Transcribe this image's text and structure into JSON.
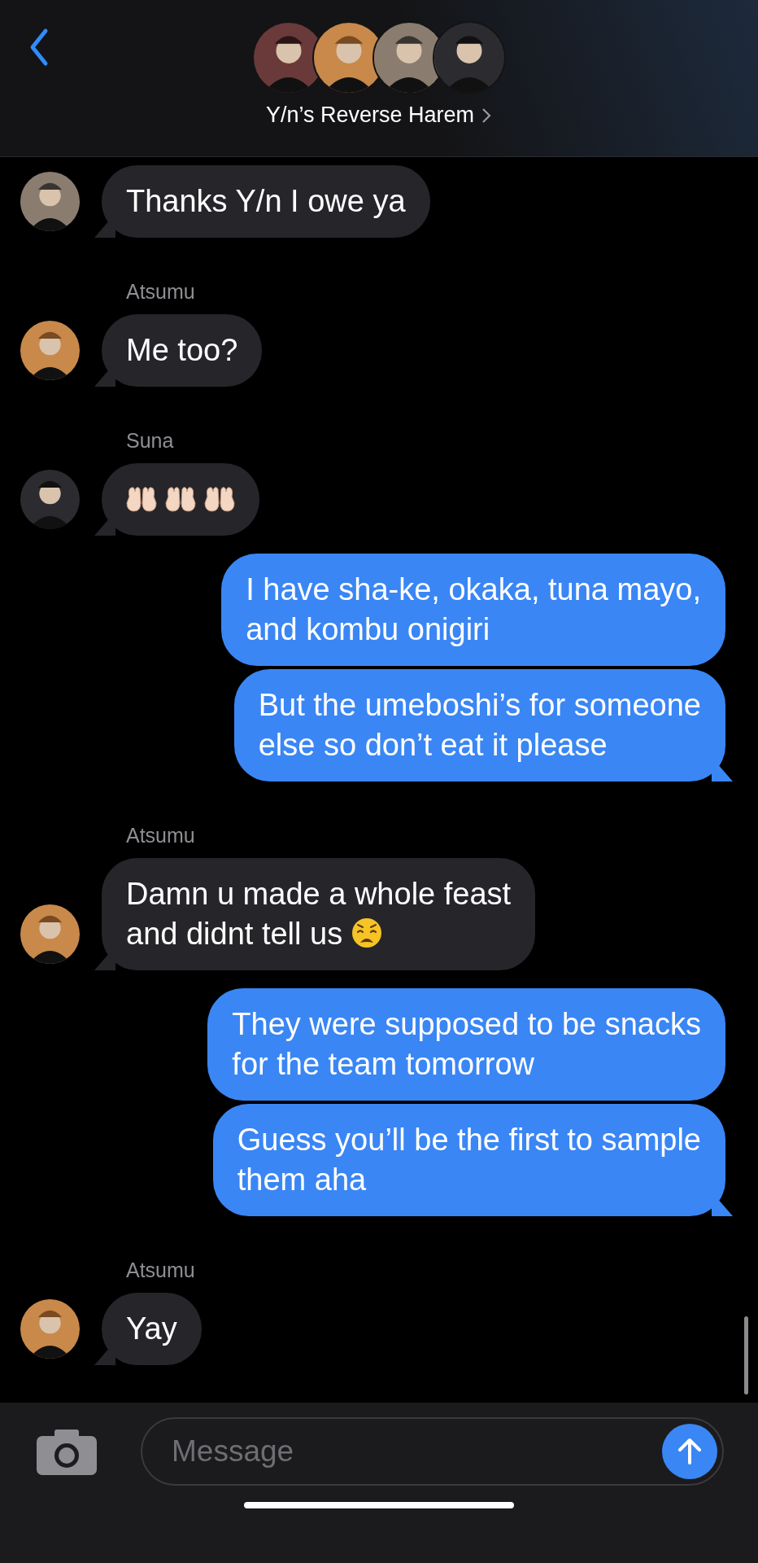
{
  "header": {
    "title": "Y/n’s Reverse Harem"
  },
  "messages": [
    {
      "kind": "received",
      "bubbles": [
        {
          "kind": "text",
          "text": "Thanks Y/n I owe ya"
        }
      ]
    },
    {
      "kind": "received",
      "name": "Atsumu",
      "bubbles": [
        {
          "kind": "text",
          "text": "Me too?"
        }
      ]
    },
    {
      "kind": "received",
      "name": "Suna",
      "bubbles": [
        {
          "kind": "emoji_row"
        }
      ]
    },
    {
      "kind": "sent",
      "bubbles": [
        {
          "kind": "text",
          "text": "I have sha-ke, okaka, tuna mayo,\nand kombu onigiri"
        },
        {
          "kind": "text",
          "text": "But the umeboshi’s for someone\nelse so don’t eat it please"
        }
      ]
    },
    {
      "kind": "received",
      "name": "Atsumu",
      "bubbles": [
        {
          "kind": "text_emoji",
          "text": "Damn u made a whole feast\nand didnt tell us"
        }
      ]
    },
    {
      "kind": "sent",
      "bubbles": [
        {
          "kind": "text",
          "text": "They were supposed to be snacks\nfor the team tomorrow"
        },
        {
          "kind": "text",
          "text": "Guess you’ll be the first to sample\nthem aha"
        }
      ]
    },
    {
      "kind": "received",
      "name": "Atsumu",
      "bubbles": [
        {
          "kind": "text",
          "text": "Yay"
        }
      ]
    }
  ],
  "composer": {
    "placeholder": "Message"
  }
}
